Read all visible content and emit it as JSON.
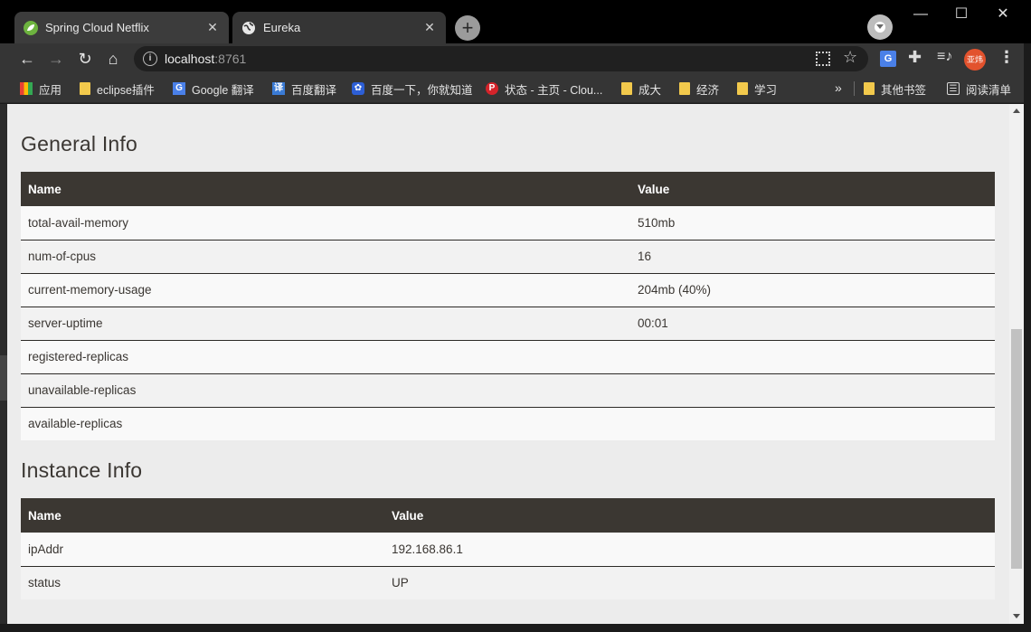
{
  "tabs": [
    {
      "title": "Spring Cloud Netflix",
      "favicon": "spring-leaf-icon",
      "close": "✕"
    },
    {
      "title": "Eureka",
      "favicon": "globe-icon",
      "close": "✕"
    }
  ],
  "new_tab_label": "+",
  "window_controls": {
    "minimize": "—",
    "maximize": "☐",
    "close": "✕"
  },
  "toolbar": {
    "back": "←",
    "forward": "→",
    "reload": "↻",
    "home": "⌂",
    "url_host": "localhost",
    "url_port": ":8761",
    "site_info": "i",
    "star": "☆",
    "translate_ext": "G",
    "extensions": "✚",
    "media": "≡♪",
    "avatar_text": "亚炜",
    "menu": "⋮"
  },
  "bookmarks": [
    {
      "label": "应用",
      "icon": "apps-grid-icon"
    },
    {
      "label": "eclipse插件",
      "icon": "folder-icon"
    },
    {
      "label": "Google 翻译",
      "icon": "google-translate-icon",
      "glyph": "G"
    },
    {
      "label": "百度翻译",
      "icon": "baidu-translate-icon",
      "glyph": "译"
    },
    {
      "label": "百度一下，你就知道",
      "icon": "baidu-paw-icon",
      "glyph": "✿"
    },
    {
      "label": "状态 - 主页 - Clou...",
      "icon": "p-logo-icon",
      "glyph": "P"
    },
    {
      "label": "成大",
      "icon": "folder-icon"
    },
    {
      "label": "经济",
      "icon": "folder-icon"
    },
    {
      "label": "学习",
      "icon": "folder-icon"
    }
  ],
  "bookmarks_more": "»",
  "other_bookmarks": "其他书签",
  "reading_list": "阅读清单",
  "reading_glyph": "☰",
  "general_info": {
    "title": "General Info",
    "headers": {
      "name": "Name",
      "value": "Value"
    },
    "rows": [
      {
        "name": "total-avail-memory",
        "value": "510mb"
      },
      {
        "name": "num-of-cpus",
        "value": "16"
      },
      {
        "name": "current-memory-usage",
        "value": "204mb (40%)"
      },
      {
        "name": "server-uptime",
        "value": "00:01"
      },
      {
        "name": "registered-replicas",
        "value": ""
      },
      {
        "name": "unavailable-replicas",
        "value": ""
      },
      {
        "name": "available-replicas",
        "value": ""
      }
    ]
  },
  "instance_info": {
    "title": "Instance Info",
    "headers": {
      "name": "Name",
      "value": "Value"
    },
    "rows": [
      {
        "name": "ipAddr",
        "value": "192.168.86.1"
      },
      {
        "name": "status",
        "value": "UP"
      }
    ]
  },
  "colors": {
    "table_header_bg": "#3b3732",
    "page_bg": "#ececec",
    "chrome_dark": "#353535"
  }
}
